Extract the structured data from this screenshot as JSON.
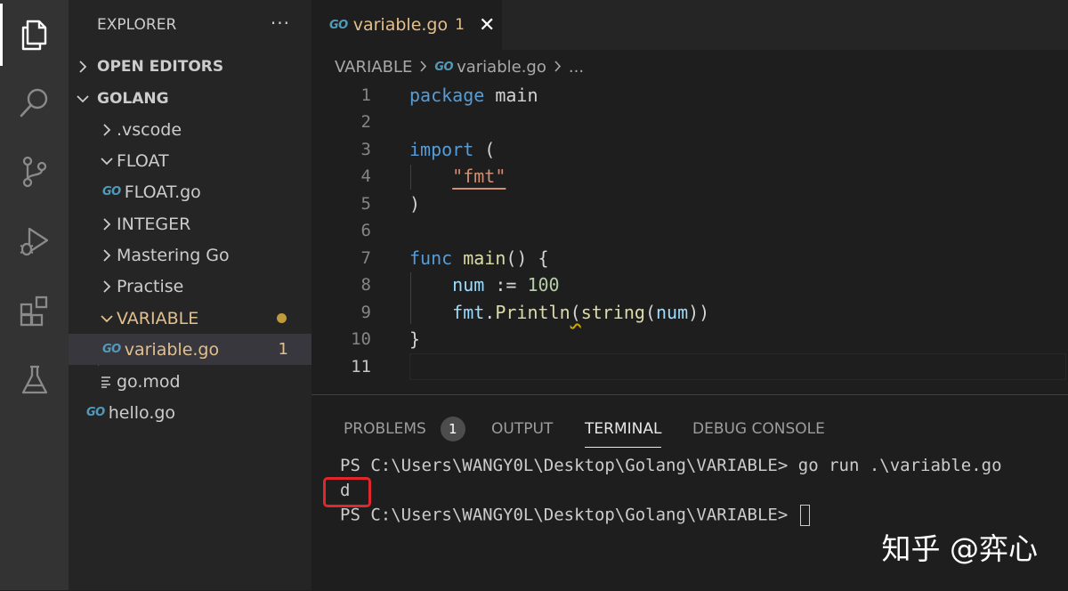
{
  "sidebar": {
    "title": "EXPLORER",
    "more": "···",
    "open_editors": "OPEN EDITORS",
    "workspace": "GOLANG",
    "items": [
      {
        "label": ".vscode"
      },
      {
        "label": "FLOAT"
      },
      {
        "label": "FLOAT.go"
      },
      {
        "label": "INTEGER"
      },
      {
        "label": "Mastering Go"
      },
      {
        "label": "Practise"
      },
      {
        "label": "VARIABLE"
      },
      {
        "label": "variable.go",
        "badge": "1"
      },
      {
        "label": "go.mod"
      },
      {
        "label": "hello.go"
      }
    ]
  },
  "editor": {
    "tab": {
      "label": "variable.go",
      "count": "1",
      "close": "✕"
    },
    "breadcrumb": {
      "folder": "VARIABLE",
      "file": "variable.go",
      "more": "..."
    },
    "line_numbers": [
      "1",
      "2",
      "3",
      "4",
      "5",
      "6",
      "7",
      "8",
      "9",
      "10",
      "11"
    ],
    "code": {
      "l1_kw": "package",
      "l1_name": "main",
      "l3_kw": "import",
      "l3_paren": "(",
      "l4_str": "\"fmt\"",
      "l5": ")",
      "l7_kw": "func",
      "l7_fn": "main",
      "l7_rest": "() {",
      "l8_var": "num",
      "l8_op": " := ",
      "l8_num": "100",
      "l9_pkg": "fmt",
      "l9_dot": ".",
      "l9_fn": "Println",
      "l9_paren": "(",
      "l9_conv": "string",
      "l9_open": "(",
      "l9_var": "num",
      "l9_close": "))",
      "l10": "}"
    }
  },
  "panel": {
    "tabs": [
      "PROBLEMS",
      "OUTPUT",
      "TERMINAL",
      "DEBUG CONSOLE"
    ],
    "problems_count": "1",
    "terminal_lines": [
      "PS C:\\Users\\WANGY0L\\Desktop\\Golang\\VARIABLE> go run .\\variable.go",
      "d",
      "PS C:\\Users\\WANGY0L\\Desktop\\Golang\\VARIABLE> "
    ]
  },
  "watermark": "知乎 @弈心",
  "icons": {
    "go_file": "GO",
    "activity": [
      "files-icon",
      "search-icon",
      "source-control-icon",
      "run-debug-icon",
      "extensions-icon",
      "testing-icon"
    ]
  },
  "colors": {
    "accent_modified": "#e2c08d",
    "keyword": "#569cd6",
    "function": "#dcdcaa",
    "string": "#ce9178",
    "highlight_box": "#e0272b"
  }
}
